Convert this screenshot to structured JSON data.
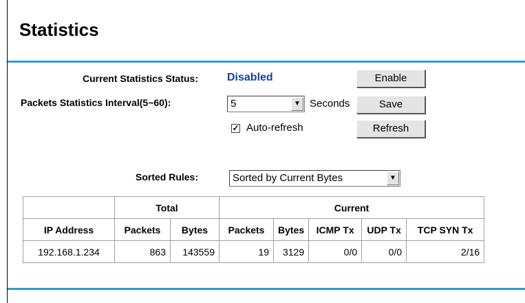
{
  "page": {
    "title": "Statistics"
  },
  "form": {
    "status_label": "Current Statistics Status:",
    "status_value": "Disabled",
    "interval_label": "Packets Statistics Interval(5~60):",
    "interval_value": "5",
    "interval_unit": "Seconds",
    "autorefresh_label": "Auto-refresh",
    "autorefresh_checked": true,
    "sorted_label": "Sorted Rules:",
    "sorted_value": "Sorted by Current Bytes"
  },
  "buttons": {
    "enable": "Enable",
    "save": "Save",
    "refresh": "Refresh"
  },
  "table": {
    "group_total": "Total",
    "group_current": "Current",
    "headers": [
      "IP Address",
      "Packets",
      "Bytes",
      "Packets",
      "Bytes",
      "ICMP Tx",
      "UDP Tx",
      "TCP SYN Tx"
    ],
    "rows": [
      [
        "192.168.1.234",
        "863",
        "143559",
        "19",
        "3129",
        "0/0",
        "0/0",
        "2/16"
      ]
    ]
  },
  "colors": {
    "accent_rule": "#2a9bd6",
    "status_text": "#1b3f95"
  }
}
